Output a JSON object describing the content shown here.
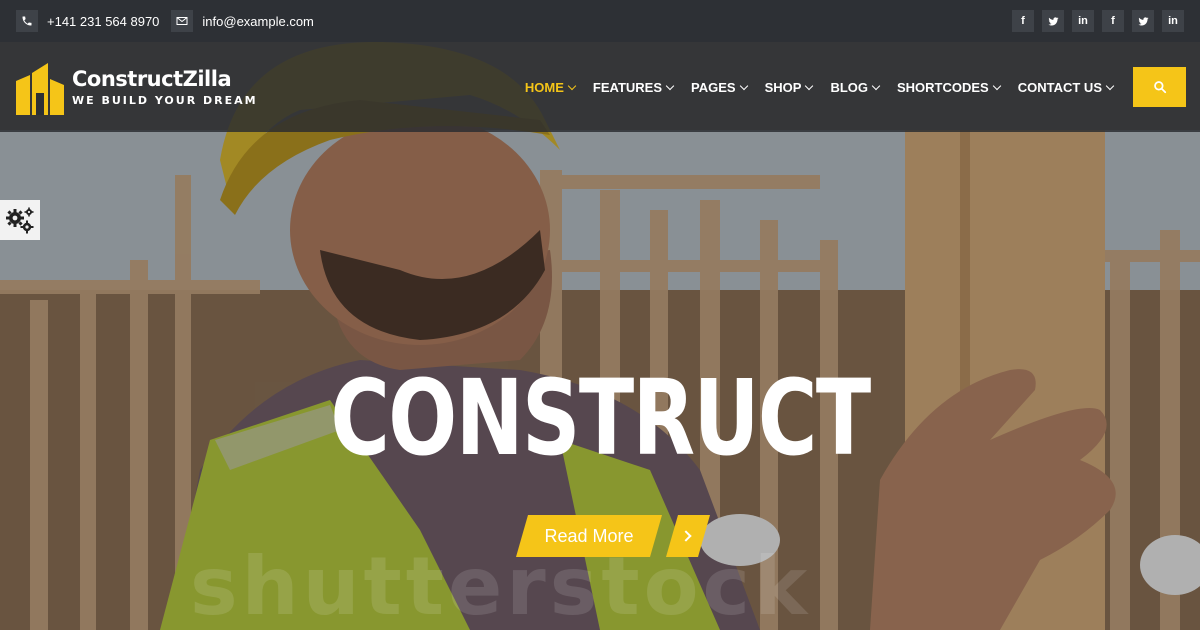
{
  "topbar": {
    "phone": "+141 231 564 8970",
    "email": "info@example.com",
    "socials": [
      "facebook-icon",
      "twitter-icon",
      "linkedin-icon",
      "facebook-icon",
      "twitter-icon",
      "linkedin-icon"
    ]
  },
  "brand": {
    "name": "ConstructZilla",
    "tagline": "WE BUILD YOUR DREAM"
  },
  "nav": {
    "items": [
      {
        "label": "HOME",
        "active": true
      },
      {
        "label": "FEATURES"
      },
      {
        "label": "PAGES"
      },
      {
        "label": "SHOP"
      },
      {
        "label": "BLOG"
      },
      {
        "label": "SHORTCODES"
      },
      {
        "label": "CONTACT US"
      }
    ]
  },
  "hero": {
    "title": "CONSTRUCT",
    "button_label": "Read More",
    "watermark": "shutterstock"
  },
  "colors": {
    "accent": "#f5c518",
    "topbar": "#2d3035"
  }
}
